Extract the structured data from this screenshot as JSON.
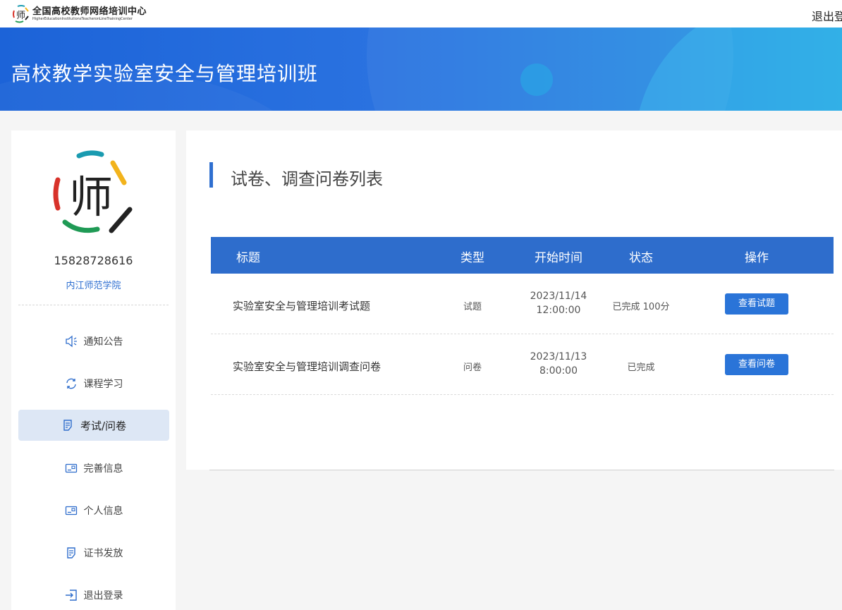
{
  "header": {
    "logo_cn": "全国高校教师网络培训中心",
    "logo_en": "HigherEducationInstitutionsTeacheronLineTrainingCenter",
    "logout": "退出登"
  },
  "banner": {
    "title": "高校教学实验室安全与管理培训班"
  },
  "profile": {
    "phone": "15828728616",
    "school": "内江师范学院"
  },
  "sidebar": {
    "items": [
      {
        "label": "通知公告",
        "icon": "speaker-icon"
      },
      {
        "label": "课程学习",
        "icon": "refresh-icon"
      },
      {
        "label": "考试/问卷",
        "icon": "document-icon",
        "active": true
      },
      {
        "label": "完善信息",
        "icon": "id-card-icon"
      },
      {
        "label": "个人信息",
        "icon": "id-card-icon"
      },
      {
        "label": "证书发放",
        "icon": "document-icon"
      },
      {
        "label": "退出登录",
        "icon": "logout-icon"
      }
    ]
  },
  "main": {
    "section_title": "试卷、调查问卷列表",
    "columns": [
      "标题",
      "类型",
      "开始时间",
      "状态",
      "操作"
    ],
    "rows": [
      {
        "title": "实验室安全与管理培训考试题",
        "type": "试题",
        "date": "2023/11/14",
        "time": "12:00:00",
        "status": "已完成 100分",
        "action": "查看试题"
      },
      {
        "title": "实验室安全与管理培训调查问卷",
        "type": "问卷",
        "date": "2023/11/13",
        "time": "8:00:00",
        "status": "已完成",
        "action": "查看问卷"
      }
    ]
  },
  "colors": {
    "primary": "#2e6dcc",
    "button": "#2a74d8",
    "active_nav": "#dde7f5",
    "link": "#2d6ed0"
  }
}
